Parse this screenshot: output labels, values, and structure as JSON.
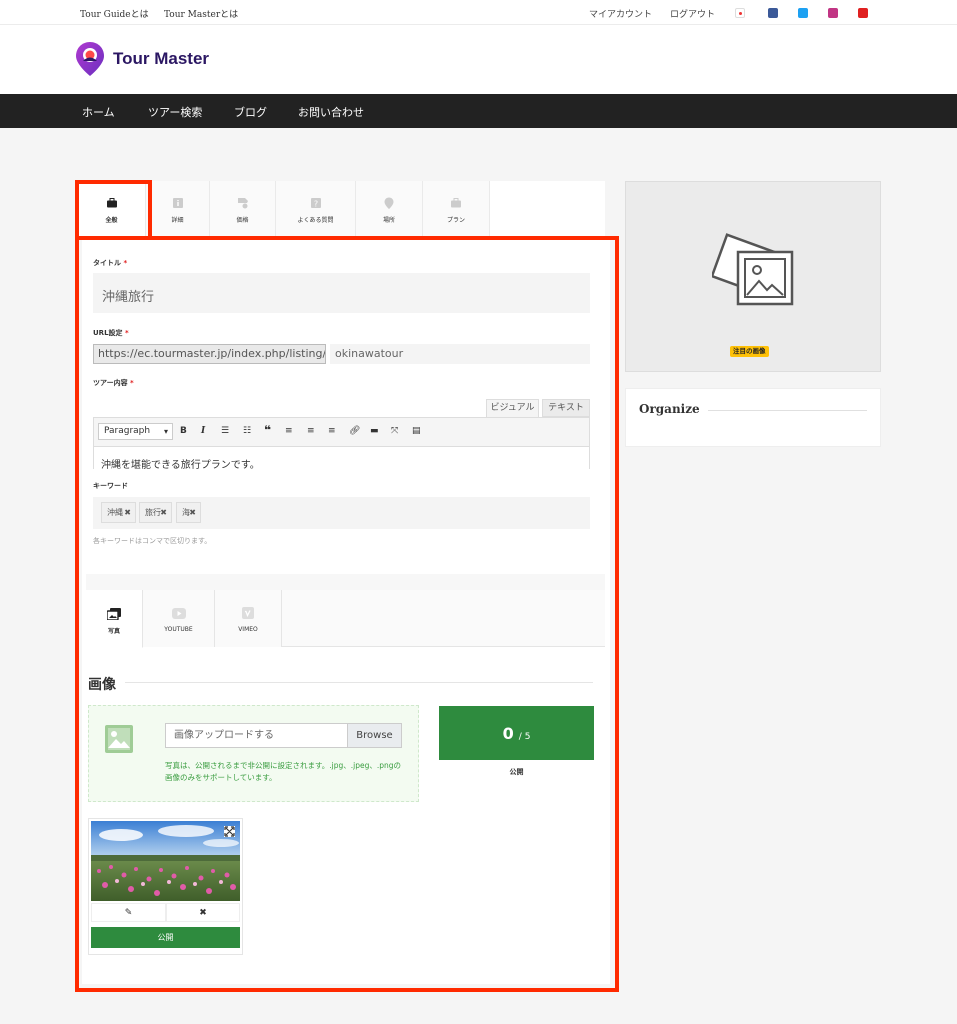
{
  "topbar": {
    "links": [
      "Tour Guideとは",
      "Tour Masterとは"
    ],
    "account": "マイアカウント",
    "logout": "ログアウト",
    "social_icons": [
      "flag-icon",
      "facebook-icon",
      "twitter-icon",
      "instagram-icon",
      "youtube-icon"
    ]
  },
  "header": {
    "brand": "Tour Master"
  },
  "nav": {
    "items": [
      "ホーム",
      "ツアー検索",
      "ブログ",
      "お問い合わせ"
    ]
  },
  "tabs": [
    {
      "label": "全般",
      "icon": "briefcase-icon"
    },
    {
      "label": "詳細",
      "icon": "info-icon"
    },
    {
      "label": "価格",
      "icon": "price-tag-icon"
    },
    {
      "label": "よくある質問",
      "icon": "question-icon"
    },
    {
      "label": "場所",
      "icon": "map-pin-icon"
    },
    {
      "label": "プラン",
      "icon": "briefcase-icon"
    }
  ],
  "form": {
    "title_label": "タイトル",
    "title_value": "沖縄旅行",
    "url_label": "URL設定",
    "url_prefix": "https://ec.tourmaster.jp/index.php/listing/",
    "url_slug": "okinawatour",
    "content_label": "ツアー内容",
    "editor_tabs": [
      "ビジュアル",
      "テキスト"
    ],
    "format_select": "Paragraph",
    "content_text": "沖縄を堪能できる旅行プランです。",
    "keyword_label": "キーワード",
    "keywords": [
      "沖縄",
      "旅行",
      "海"
    ],
    "keyword_hint": "各キーワードはコンマで区切ります。",
    "required_mark": "*"
  },
  "media_tabs": [
    {
      "label": "写真",
      "icon": "photos-icon"
    },
    {
      "label": "YOUTUBE",
      "icon": "youtube-icon"
    },
    {
      "label": "VIMEO",
      "icon": "vimeo-icon"
    }
  ],
  "images": {
    "heading": "画像",
    "upload_placeholder": "画像アップロードする",
    "browse": "Browse",
    "note": "写真は、公開されるまで非公開に設定されます。.jpg、.jpeg、.pngの画像のみをサポートしています。",
    "count": "0",
    "max": "/ 5",
    "count_caption": "公開",
    "thumb_publish": "公開"
  },
  "sidebar": {
    "featured_badge": "注目の画像",
    "organize": "Organize"
  },
  "colors": {
    "accent_red": "#ff2a00",
    "green": "#2e8b3e",
    "nav_bg": "#222222",
    "brand": "#2b1763"
  }
}
